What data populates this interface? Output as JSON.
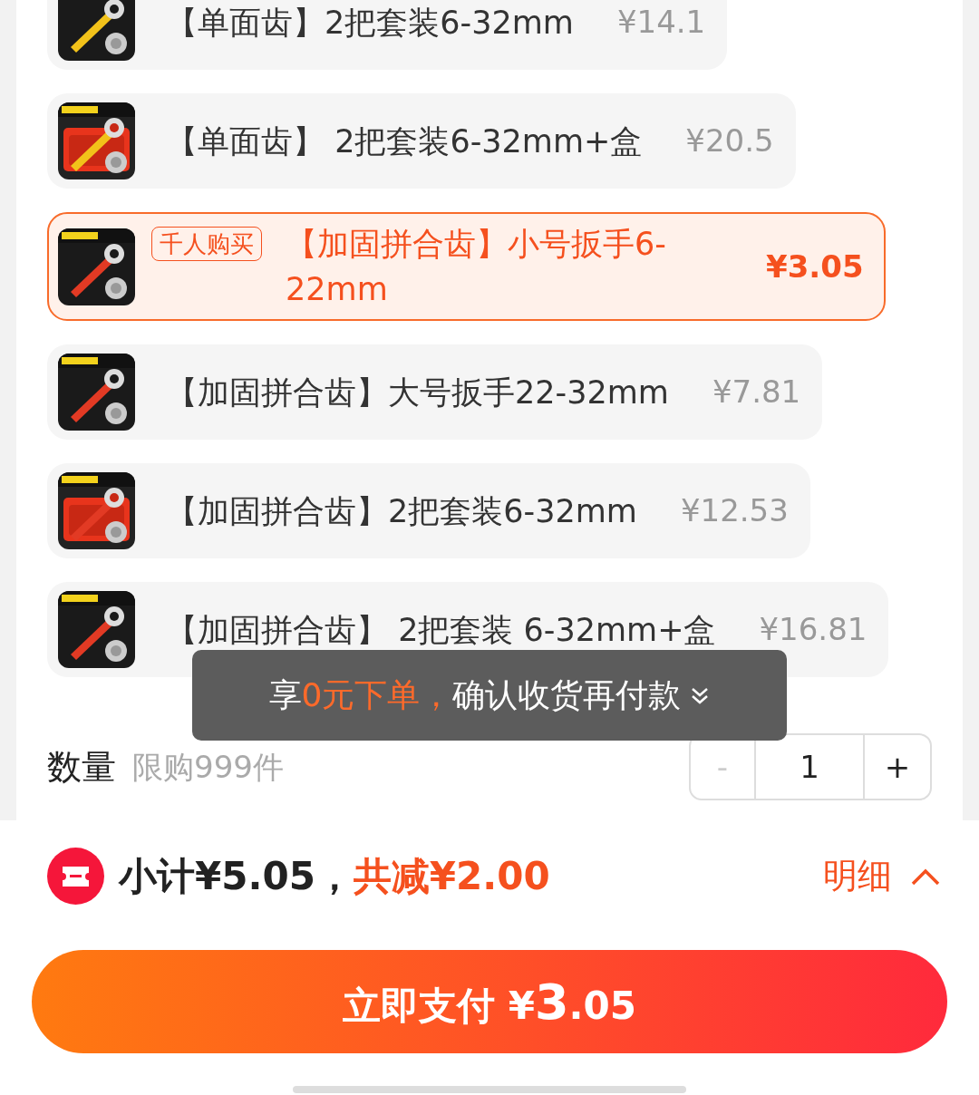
{
  "options": [
    {
      "title": "【单面齿】2把套装6-32mm",
      "price": "¥14.1",
      "selected": false
    },
    {
      "title": "【单面齿】 2把套装6-32mm+盒",
      "price": "¥20.5",
      "selected": false
    },
    {
      "badge": "千人购买",
      "title": "【加固拼合齿】小号扳手6-22mm",
      "price": "¥3.05",
      "selected": true
    },
    {
      "title": "【加固拼合齿】大号扳手22-32mm",
      "price": "¥7.81",
      "selected": false
    },
    {
      "title": "【加固拼合齿】2把套装6-32mm",
      "price": "¥12.53",
      "selected": false
    },
    {
      "title": "【加固拼合齿】 2把套装 6-32mm+盒",
      "price": "¥16.81",
      "selected": false
    }
  ],
  "quantity": {
    "label": "数量",
    "limit": "限购999件",
    "minus": "-",
    "value": "1",
    "plus": "+"
  },
  "tooltip": {
    "prefix": "享",
    "highlight": "0元下单，",
    "suffix": "确认收货再付款"
  },
  "summary": {
    "subtotal": "小计¥5.05，",
    "discount": "共减¥2.00",
    "details": "明细"
  },
  "pay_button": {
    "label": "立即支付",
    "currency": "¥",
    "major": "3",
    "minor": ".05"
  }
}
